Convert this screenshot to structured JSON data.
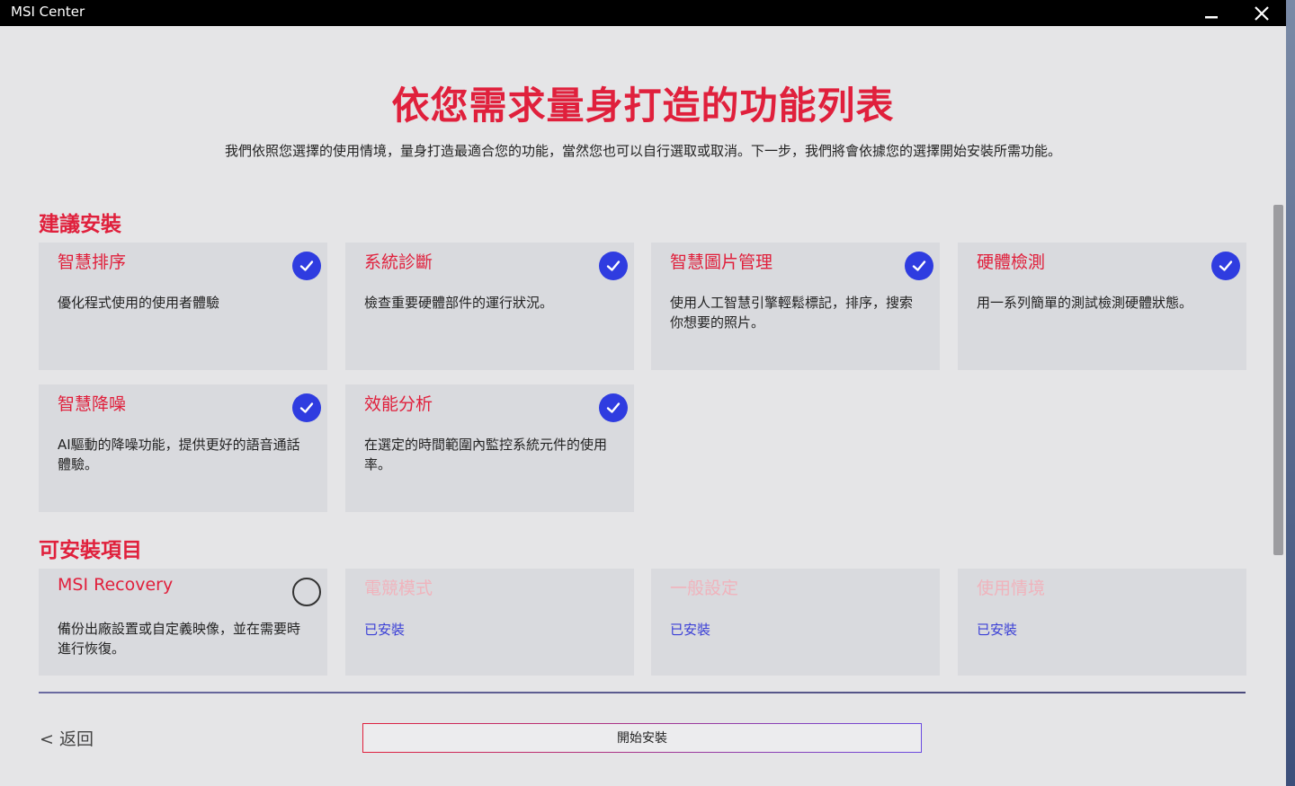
{
  "window": {
    "title": "MSI Center"
  },
  "header": {
    "title": "依您需求量身打造的功能列表",
    "subtitle": "我們依照您選擇的使用情境，量身打造最適合您的功能，當然您也可以自行選取或取消。下一步，我們將會依據您的選擇開始安裝所需功能。"
  },
  "recommended": {
    "title": "建議安裝",
    "items": [
      {
        "title": "智慧排序",
        "desc": "優化程式使用的使用者體驗",
        "checked": true
      },
      {
        "title": "系統診斷",
        "desc": "檢查重要硬體部件的運行狀況。",
        "checked": true
      },
      {
        "title": "智慧圖片管理",
        "desc": "使用人工智慧引擎輕鬆標記，排序，搜索你想要的照片。",
        "checked": true
      },
      {
        "title": "硬體檢測",
        "desc": "用一系列簡單的測試檢測硬體狀態。",
        "checked": true
      },
      {
        "title": "智慧降噪",
        "desc": "AI驅動的降噪功能，提供更好的語音通話體驗。",
        "checked": true
      },
      {
        "title": "效能分析",
        "desc": "在選定的時間範圍內監控系統元件的使用率。",
        "checked": true
      }
    ]
  },
  "installable": {
    "title": "可安裝項目",
    "items": [
      {
        "title": "MSI Recovery",
        "desc": "備份出廠設置或自定義映像，並在需要時進行恢復。",
        "checked": false
      },
      {
        "title": "電競模式",
        "status": "已安裝"
      },
      {
        "title": "一般設定",
        "status": "已安裝"
      },
      {
        "title": "使用情境",
        "status": "已安裝"
      }
    ]
  },
  "footer": {
    "back_label": "< 返回",
    "install_label": "開始安裝"
  },
  "colors": {
    "accent": "#e0203c",
    "check": "#2f3ce0",
    "installed": "#3a3fd6"
  }
}
